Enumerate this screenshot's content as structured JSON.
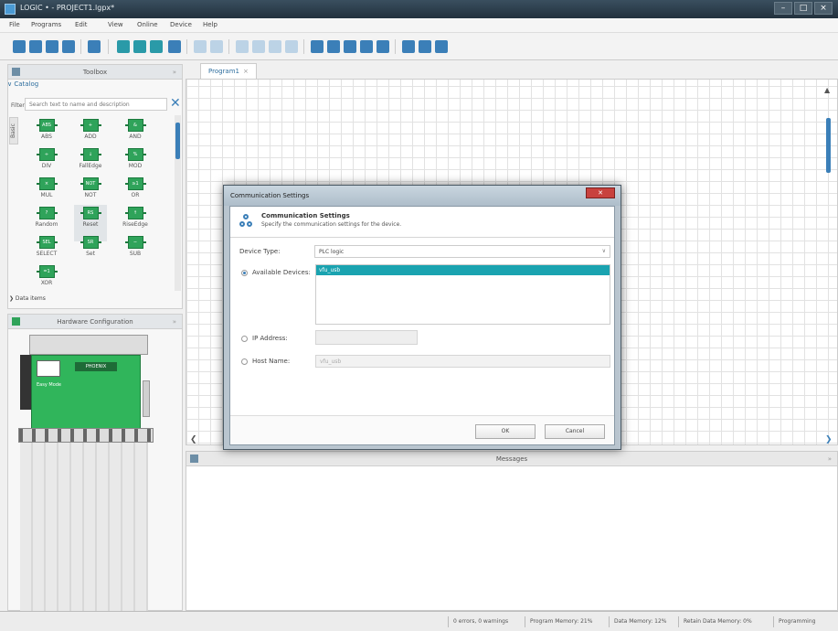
{
  "window": {
    "title": "LOGIC • - PROJECT1.lgpx*",
    "controls": [
      "–",
      "□",
      "×"
    ]
  },
  "menu": [
    "File",
    "Programs",
    "Edit",
    "View",
    "Online",
    "Device",
    "Help"
  ],
  "toolbox": {
    "title": "Toolbox",
    "catalog_title": "∨ Catalog",
    "filter_label": "Filter:",
    "filter_placeholder": "Search text to name and description",
    "filter_clear": "✕",
    "basic_tab": "Basic",
    "blocks": [
      {
        "label": "ABS",
        "icon": "ABS"
      },
      {
        "label": "ADD",
        "icon": "+"
      },
      {
        "label": "AND",
        "icon": "&"
      },
      {
        "label": "DIV",
        "icon": "÷"
      },
      {
        "label": "FallEdge",
        "icon": "↓"
      },
      {
        "label": "MOD",
        "icon": "%"
      },
      {
        "label": "MUL",
        "icon": "×"
      },
      {
        "label": "NOT",
        "icon": "NOT"
      },
      {
        "label": "OR",
        "icon": "≥1"
      },
      {
        "label": "Random",
        "icon": "?"
      },
      {
        "label": "Reset",
        "icon": "RS"
      },
      {
        "label": "RiseEdge",
        "icon": "↑"
      },
      {
        "label": "SELECT",
        "icon": "SEL"
      },
      {
        "label": "Set",
        "icon": "SR"
      },
      {
        "label": "SUB",
        "icon": "−"
      },
      {
        "label": "XOR",
        "icon": "=1"
      }
    ],
    "data_items": "❯ Data items"
  },
  "hardware": {
    "title": "Hardware Configuration",
    "device_logo": "PHOENIX",
    "device_label": "Easy Mode"
  },
  "editor": {
    "tab_label": "Program1",
    "tab_close": "×"
  },
  "messages": {
    "title": "Messages"
  },
  "status": [
    "0 errors, 0 warnings",
    "Program Memory: 21%",
    "Data Memory: 12%",
    "Retain Data Memory: 0%",
    "Programming"
  ],
  "dialog": {
    "title": "Communication Settings",
    "close": "✕",
    "header_title": "Communication Settings",
    "header_desc": "Specify the communication settings for the device.",
    "device_type_label": "Device Type:",
    "device_type_value": "PLC logic",
    "available_label": "Available Devices:",
    "available_devices": [
      "vfu_usb"
    ],
    "ip_label": "IP Address:",
    "host_label": "Host Name:",
    "host_value": "vfu_usb",
    "ok": "OK",
    "cancel": "Cancel"
  }
}
